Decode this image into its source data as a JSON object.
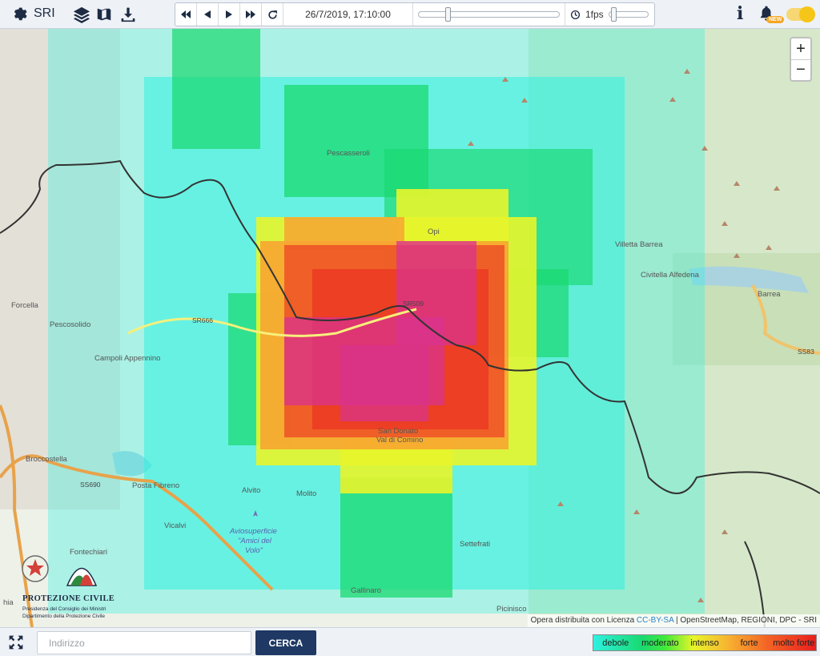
{
  "app": {
    "title": "SRI"
  },
  "player": {
    "datetime": "26/7/2019, 17:10:00",
    "time_position": 0.2,
    "speed_label": "1fps",
    "speed_position": 0.05
  },
  "notifications": {
    "badge": "NEW"
  },
  "zoom": {
    "in": "+",
    "out": "−"
  },
  "map_labels": [
    {
      "text": "Pescasseroli",
      "name": "label-pescasseroli"
    },
    {
      "text": "Opi",
      "name": "label-opi"
    },
    {
      "text": "Villetta Barrea",
      "name": "label-villetta-barrea"
    },
    {
      "text": "Civitella Alfedena",
      "name": "label-civitella-alfedena"
    },
    {
      "text": "Barrea",
      "name": "label-barrea"
    },
    {
      "text": "SS83",
      "name": "label-ss83"
    },
    {
      "text": "SR509",
      "name": "label-sr509"
    },
    {
      "text": "SR666",
      "name": "label-sr666"
    },
    {
      "text": "Forcella",
      "name": "label-forcella"
    },
    {
      "text": "Pescosolido",
      "name": "label-pescosolido"
    },
    {
      "text": "Campoli Appennino",
      "name": "label-campoli-appennino"
    },
    {
      "text": "San Donato",
      "name": "label-san-donato"
    },
    {
      "text": "Val di Comino",
      "name": "label-val-di-comino"
    },
    {
      "text": "Broccostella",
      "name": "label-broccostella"
    },
    {
      "text": "SS690",
      "name": "label-ss690"
    },
    {
      "text": "Posta Fibreno",
      "name": "label-posta-fibreno"
    },
    {
      "text": "Alvito",
      "name": "label-alvito"
    },
    {
      "text": "Molito",
      "name": "label-molito"
    },
    {
      "text": "Vicalvi",
      "name": "label-vicalvi"
    },
    {
      "text": "Aviosuperficie",
      "name": "label-aviosuperficie"
    },
    {
      "text": "\"Amici del",
      "name": "label-amici-del"
    },
    {
      "text": "Volo\"",
      "name": "label-volo"
    },
    {
      "text": "Fontechiari",
      "name": "label-fontechiari"
    },
    {
      "text": "Settefrati",
      "name": "label-settefrati"
    },
    {
      "text": "Gallinaro",
      "name": "label-gallinaro"
    },
    {
      "text": "Picinisco",
      "name": "label-picinisco"
    },
    {
      "text": "hia",
      "name": "label-hia"
    }
  ],
  "radar": {
    "description_levels": [
      "debole",
      "moderato",
      "intenso",
      "forte",
      "molto forte"
    ],
    "colors": {
      "debole": "#2ff0e0",
      "moderato": "#19d96f",
      "intenso": "#e8f52a",
      "forte": "#f7a531",
      "molto_forte": "#e91f1f",
      "extreme": "#d9338f"
    }
  },
  "logo": {
    "title": "PROTEZIONE CIVILE",
    "subtitle1": "Presidenza del Consiglio dei Ministri",
    "subtitle2": "Dipartimento della Protezione Civile"
  },
  "attribution": {
    "prefix": "Opera distribuita con Licenza ",
    "license": "CC-BY-SA",
    "suffix": " | OpenStreetMap, REGIONI, DPC - SRI"
  },
  "search": {
    "placeholder": "Indirizzo",
    "value": "",
    "button": "CERCA"
  },
  "legend": [
    "debole",
    "moderato",
    "intenso",
    "forte",
    "molto forte"
  ]
}
